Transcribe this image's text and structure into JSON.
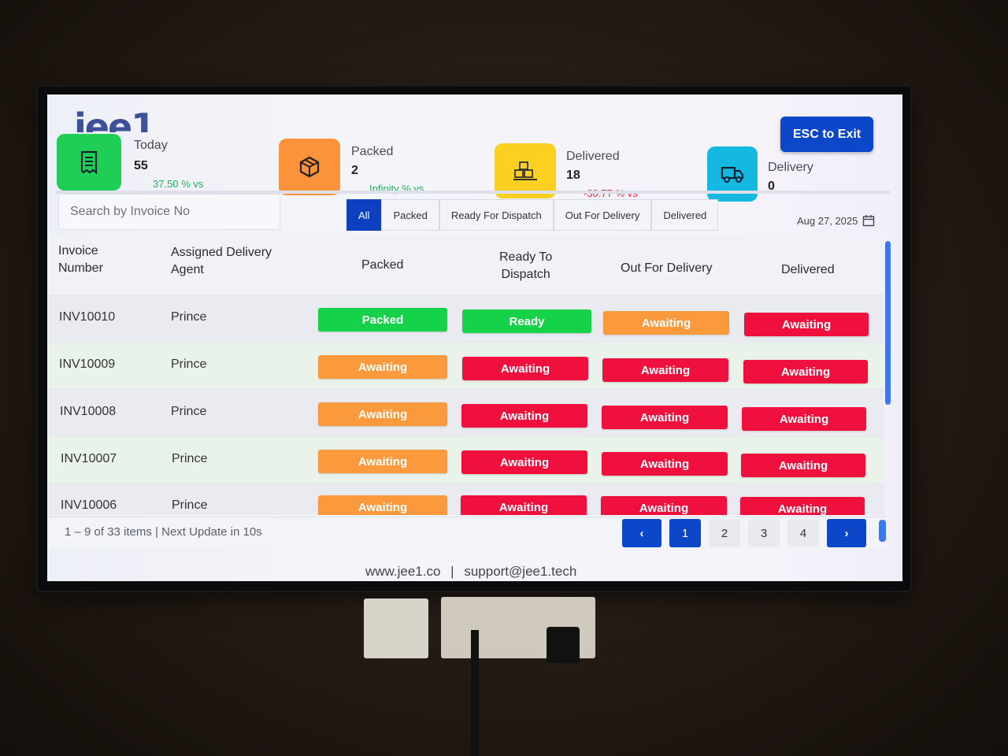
{
  "header": {
    "logo_partial": "jee1",
    "exit_label": "ESC to Exit"
  },
  "stats": [
    {
      "label": "Today",
      "value": "55",
      "delta": "37.50 % vs",
      "trend": "positive",
      "icon": "receipt-icon",
      "color": "#1fcf55"
    },
    {
      "label": "Packed",
      "value": "2",
      "delta": "Infinity % vs",
      "trend": "positive",
      "icon": "box-icon",
      "color": "#fb923c"
    },
    {
      "label": "Delivered",
      "value": "18",
      "delta": "-30.77 % vs",
      "trend": "negative",
      "icon": "packages-icon",
      "color": "#fbd020"
    },
    {
      "label": "Delivery",
      "value": "0",
      "delta": "",
      "trend": "neutral",
      "icon": "truck-icon",
      "color": "#14b8e0"
    }
  ],
  "search": {
    "placeholder": "Search by Invoice No"
  },
  "filters": {
    "tabs": [
      "All",
      "Packed",
      "Ready For Dispatch",
      "Out For Delivery",
      "Delivered"
    ],
    "active": "All"
  },
  "date": "Aug 27, 2025",
  "table": {
    "headers": {
      "invoice_1": "Invoice",
      "invoice_2": "Number",
      "agent_1": "Assigned Delivery",
      "agent_2": "Agent",
      "packed": "Packed",
      "ready_1": "Ready To",
      "ready_2": "Dispatch",
      "out": "Out For Delivery",
      "delivered": "Delivered"
    },
    "rows": [
      {
        "invoice": "INV10010",
        "agent": "Prince",
        "packed": "Packed",
        "ready": "Ready",
        "out": "Awaiting",
        "delivered": "Awaiting"
      },
      {
        "invoice": "INV10009",
        "agent": "Prince",
        "packed": "Awaiting",
        "ready": "Awaiting",
        "out": "Awaiting",
        "delivered": "Awaiting"
      },
      {
        "invoice": "INV10008",
        "agent": "Prince",
        "packed": "Awaiting",
        "ready": "Awaiting",
        "out": "Awaiting",
        "delivered": "Awaiting"
      },
      {
        "invoice": "INV10007",
        "agent": "Prince",
        "packed": "Awaiting",
        "ready": "Awaiting",
        "out": "Awaiting",
        "delivered": "Awaiting"
      },
      {
        "invoice": "INV10006",
        "agent": "Prince",
        "packed": "Awaiting",
        "ready": "Awaiting",
        "out": "Awaiting",
        "delivered": "Awaiting"
      }
    ]
  },
  "pagination": {
    "summary": "1 – 9 of 33 items | Next Update in 10s",
    "pages": [
      "1",
      "2",
      "3",
      "4"
    ],
    "current": "1",
    "prev": "‹",
    "next": "›"
  },
  "footer": {
    "site": "www.jee1.co",
    "separator": "|",
    "email": "support@jee1.tech"
  }
}
